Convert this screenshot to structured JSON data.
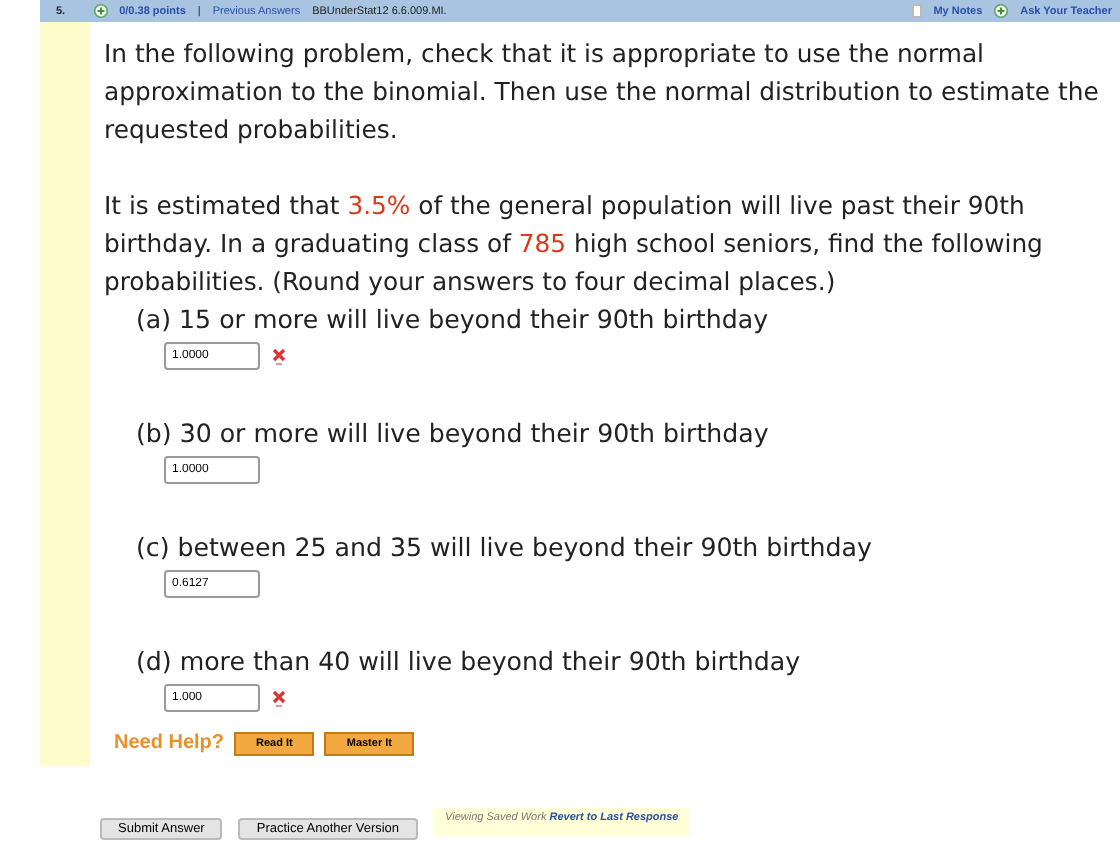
{
  "header": {
    "number": "5.",
    "points": "0/0.38 points",
    "separator": "|",
    "previous_answers": "Previous Answers",
    "problem_id": "BBUnderStat12 6.6.009.MI.",
    "my_notes": "My Notes",
    "ask_teacher": "Ask Your Teacher"
  },
  "intro": "In the following problem, check that it is appropriate to use the normal approximation to the binomial. Then use the normal distribution to estimate the requested probabilities.",
  "problem": [
    {
      "text": "It is estimated that ",
      "highlighted": false
    },
    {
      "text": "3.5%",
      "highlighted": true
    },
    {
      "text": " of the general population will live past their 90th birthday. In a graduating class of ",
      "highlighted": false
    },
    {
      "text": "785",
      "highlighted": true
    },
    {
      "text": " high school seniors, find the following probabilities. (Round your answers to four decimal places.)",
      "highlighted": false
    }
  ],
  "parts": [
    {
      "label": "(a) 15 or more will live beyond their 90th birthday",
      "answer": "1.0000",
      "incorrect": true
    },
    {
      "label": "(b) 30 or more will live beyond their 90th birthday",
      "answer": "1.0000",
      "incorrect": false
    },
    {
      "label": "(c) between 25 and 35 will live beyond their 90th birthday",
      "answer": "0.6127",
      "incorrect": false
    },
    {
      "label": "(d) more than 40 will live beyond their 90th birthday",
      "answer": "1.000",
      "incorrect": true
    }
  ],
  "help": {
    "label": "Need Help?",
    "buttons": [
      "Read It",
      "Master It"
    ]
  },
  "footer": {
    "buttons": [
      "Submit Answer",
      "Practice Another Version"
    ],
    "notice": "Viewing Saved Work",
    "revert": "Revert to Last Response"
  }
}
